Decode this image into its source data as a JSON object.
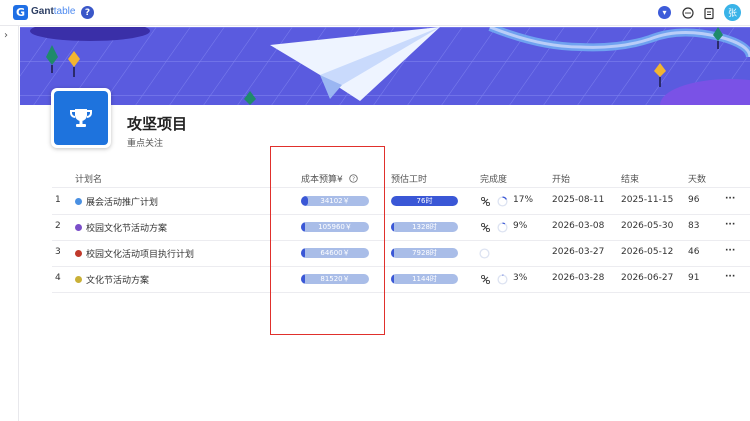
{
  "app": {
    "logo_letter": "G",
    "name_bold": "Gant",
    "name_light": "table",
    "help": "?",
    "avatar": "张"
  },
  "sidebar": {
    "toggle": "›"
  },
  "project": {
    "title": "攻坚项目",
    "subtitle": "重点关注"
  },
  "columns": {
    "name": "计划名",
    "cost": "成本预算¥",
    "hours": "预估工时",
    "progress": "完成度",
    "start": "开始",
    "end": "结束",
    "days": "天数"
  },
  "rows": [
    {
      "index": "1",
      "name": "展会活动推广计划",
      "dot_color": "#4a90e2",
      "cost": "34102￥",
      "cost_fill": 0.1,
      "hours": "76时",
      "hours_fill": 1.0,
      "progress_pct": 0.17,
      "progress": "17%",
      "start": "2025-08-11",
      "end": "2025-11-15",
      "days": "96",
      "more": "···"
    },
    {
      "index": "2",
      "name": "校园文化节活动方案",
      "dot_color": "#7b4fc9",
      "cost": "105960￥",
      "cost_fill": 0.04,
      "hours": "1328时",
      "hours_fill": 0.05,
      "progress_pct": 0.09,
      "progress": "9%",
      "start": "2026-03-08",
      "end": "2026-05-30",
      "days": "83",
      "more": "···"
    },
    {
      "index": "3",
      "name": "校园文化活动项目执行计划",
      "dot_color": "#c0392b",
      "cost": "64600￥",
      "cost_fill": 0.02,
      "hours": "7928时",
      "hours_fill": 0.0,
      "progress_pct": 0,
      "progress": "",
      "start": "2026-03-27",
      "end": "2026-05-12",
      "days": "46",
      "more": "···"
    },
    {
      "index": "4",
      "name": "文化节活动方案",
      "dot_color": "#c9b037",
      "cost": "81520￥",
      "cost_fill": 0.02,
      "hours": "1144时",
      "hours_fill": 0.0,
      "progress_pct": 0.03,
      "progress": "3%",
      "start": "2026-03-28",
      "end": "2026-06-27",
      "days": "91",
      "more": "···"
    }
  ],
  "colors": {
    "accent": "#3a57d6",
    "bar_bg": "#a9bde8",
    "highlight": "#e0302c",
    "banner": "#5b5ce0"
  }
}
